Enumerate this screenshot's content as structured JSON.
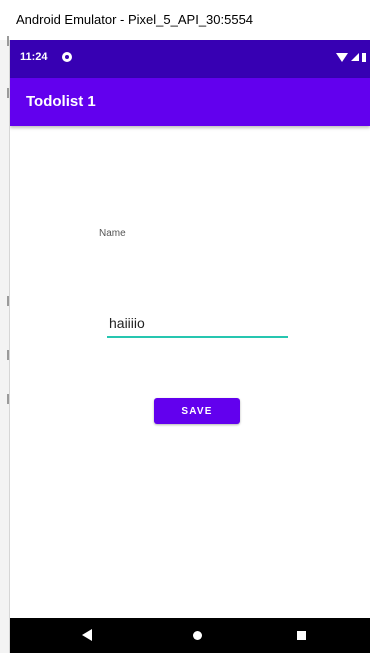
{
  "window": {
    "title": "Android Emulator - Pixel_5_API_30:5554"
  },
  "status_bar": {
    "time": "11:24",
    "icons": [
      "notification-icon",
      "wifi-icon",
      "signal-icon",
      "battery-icon"
    ]
  },
  "app_bar": {
    "title": "Todolist 1"
  },
  "form": {
    "name_label": "Name",
    "name_value": "haiiiio",
    "save_label": "SAVE"
  },
  "nav_bar": {
    "icons": [
      "back-icon",
      "home-icon",
      "recents-icon"
    ]
  },
  "colors": {
    "status_bar": "#3700b3",
    "app_bar": "#6200ee",
    "button": "#6200ee",
    "input_underline": "#26c6b0",
    "nav_bar": "#000000"
  }
}
